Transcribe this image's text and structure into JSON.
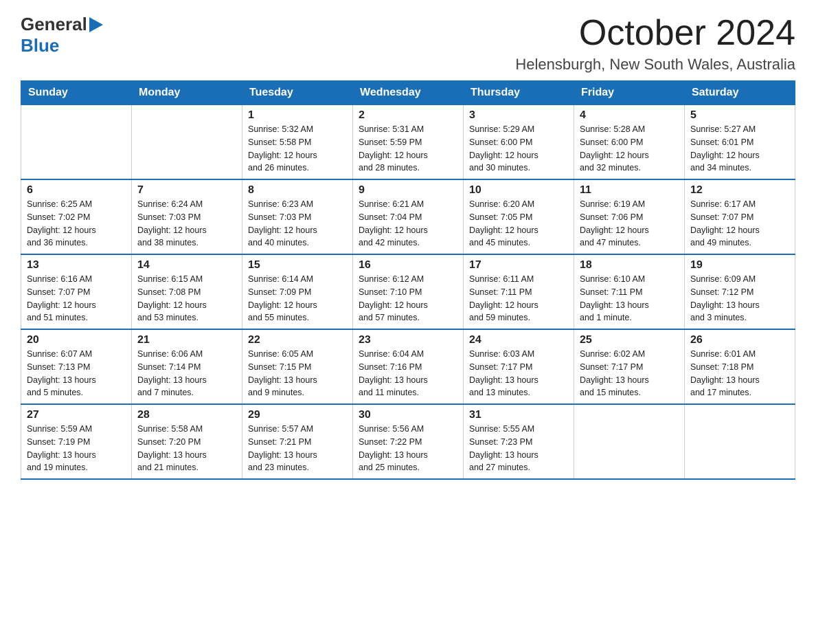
{
  "logo": {
    "general": "General",
    "blue": "Blue"
  },
  "header": {
    "title": "October 2024",
    "subtitle": "Helensburgh, New South Wales, Australia"
  },
  "calendar": {
    "days_of_week": [
      "Sunday",
      "Monday",
      "Tuesday",
      "Wednesday",
      "Thursday",
      "Friday",
      "Saturday"
    ],
    "weeks": [
      [
        {
          "day": "",
          "info": ""
        },
        {
          "day": "",
          "info": ""
        },
        {
          "day": "1",
          "info": "Sunrise: 5:32 AM\nSunset: 5:58 PM\nDaylight: 12 hours\nand 26 minutes."
        },
        {
          "day": "2",
          "info": "Sunrise: 5:31 AM\nSunset: 5:59 PM\nDaylight: 12 hours\nand 28 minutes."
        },
        {
          "day": "3",
          "info": "Sunrise: 5:29 AM\nSunset: 6:00 PM\nDaylight: 12 hours\nand 30 minutes."
        },
        {
          "day": "4",
          "info": "Sunrise: 5:28 AM\nSunset: 6:00 PM\nDaylight: 12 hours\nand 32 minutes."
        },
        {
          "day": "5",
          "info": "Sunrise: 5:27 AM\nSunset: 6:01 PM\nDaylight: 12 hours\nand 34 minutes."
        }
      ],
      [
        {
          "day": "6",
          "info": "Sunrise: 6:25 AM\nSunset: 7:02 PM\nDaylight: 12 hours\nand 36 minutes."
        },
        {
          "day": "7",
          "info": "Sunrise: 6:24 AM\nSunset: 7:03 PM\nDaylight: 12 hours\nand 38 minutes."
        },
        {
          "day": "8",
          "info": "Sunrise: 6:23 AM\nSunset: 7:03 PM\nDaylight: 12 hours\nand 40 minutes."
        },
        {
          "day": "9",
          "info": "Sunrise: 6:21 AM\nSunset: 7:04 PM\nDaylight: 12 hours\nand 42 minutes."
        },
        {
          "day": "10",
          "info": "Sunrise: 6:20 AM\nSunset: 7:05 PM\nDaylight: 12 hours\nand 45 minutes."
        },
        {
          "day": "11",
          "info": "Sunrise: 6:19 AM\nSunset: 7:06 PM\nDaylight: 12 hours\nand 47 minutes."
        },
        {
          "day": "12",
          "info": "Sunrise: 6:17 AM\nSunset: 7:07 PM\nDaylight: 12 hours\nand 49 minutes."
        }
      ],
      [
        {
          "day": "13",
          "info": "Sunrise: 6:16 AM\nSunset: 7:07 PM\nDaylight: 12 hours\nand 51 minutes."
        },
        {
          "day": "14",
          "info": "Sunrise: 6:15 AM\nSunset: 7:08 PM\nDaylight: 12 hours\nand 53 minutes."
        },
        {
          "day": "15",
          "info": "Sunrise: 6:14 AM\nSunset: 7:09 PM\nDaylight: 12 hours\nand 55 minutes."
        },
        {
          "day": "16",
          "info": "Sunrise: 6:12 AM\nSunset: 7:10 PM\nDaylight: 12 hours\nand 57 minutes."
        },
        {
          "day": "17",
          "info": "Sunrise: 6:11 AM\nSunset: 7:11 PM\nDaylight: 12 hours\nand 59 minutes."
        },
        {
          "day": "18",
          "info": "Sunrise: 6:10 AM\nSunset: 7:11 PM\nDaylight: 13 hours\nand 1 minute."
        },
        {
          "day": "19",
          "info": "Sunrise: 6:09 AM\nSunset: 7:12 PM\nDaylight: 13 hours\nand 3 minutes."
        }
      ],
      [
        {
          "day": "20",
          "info": "Sunrise: 6:07 AM\nSunset: 7:13 PM\nDaylight: 13 hours\nand 5 minutes."
        },
        {
          "day": "21",
          "info": "Sunrise: 6:06 AM\nSunset: 7:14 PM\nDaylight: 13 hours\nand 7 minutes."
        },
        {
          "day": "22",
          "info": "Sunrise: 6:05 AM\nSunset: 7:15 PM\nDaylight: 13 hours\nand 9 minutes."
        },
        {
          "day": "23",
          "info": "Sunrise: 6:04 AM\nSunset: 7:16 PM\nDaylight: 13 hours\nand 11 minutes."
        },
        {
          "day": "24",
          "info": "Sunrise: 6:03 AM\nSunset: 7:17 PM\nDaylight: 13 hours\nand 13 minutes."
        },
        {
          "day": "25",
          "info": "Sunrise: 6:02 AM\nSunset: 7:17 PM\nDaylight: 13 hours\nand 15 minutes."
        },
        {
          "day": "26",
          "info": "Sunrise: 6:01 AM\nSunset: 7:18 PM\nDaylight: 13 hours\nand 17 minutes."
        }
      ],
      [
        {
          "day": "27",
          "info": "Sunrise: 5:59 AM\nSunset: 7:19 PM\nDaylight: 13 hours\nand 19 minutes."
        },
        {
          "day": "28",
          "info": "Sunrise: 5:58 AM\nSunset: 7:20 PM\nDaylight: 13 hours\nand 21 minutes."
        },
        {
          "day": "29",
          "info": "Sunrise: 5:57 AM\nSunset: 7:21 PM\nDaylight: 13 hours\nand 23 minutes."
        },
        {
          "day": "30",
          "info": "Sunrise: 5:56 AM\nSunset: 7:22 PM\nDaylight: 13 hours\nand 25 minutes."
        },
        {
          "day": "31",
          "info": "Sunrise: 5:55 AM\nSunset: 7:23 PM\nDaylight: 13 hours\nand 27 minutes."
        },
        {
          "day": "",
          "info": ""
        },
        {
          "day": "",
          "info": ""
        }
      ]
    ]
  }
}
